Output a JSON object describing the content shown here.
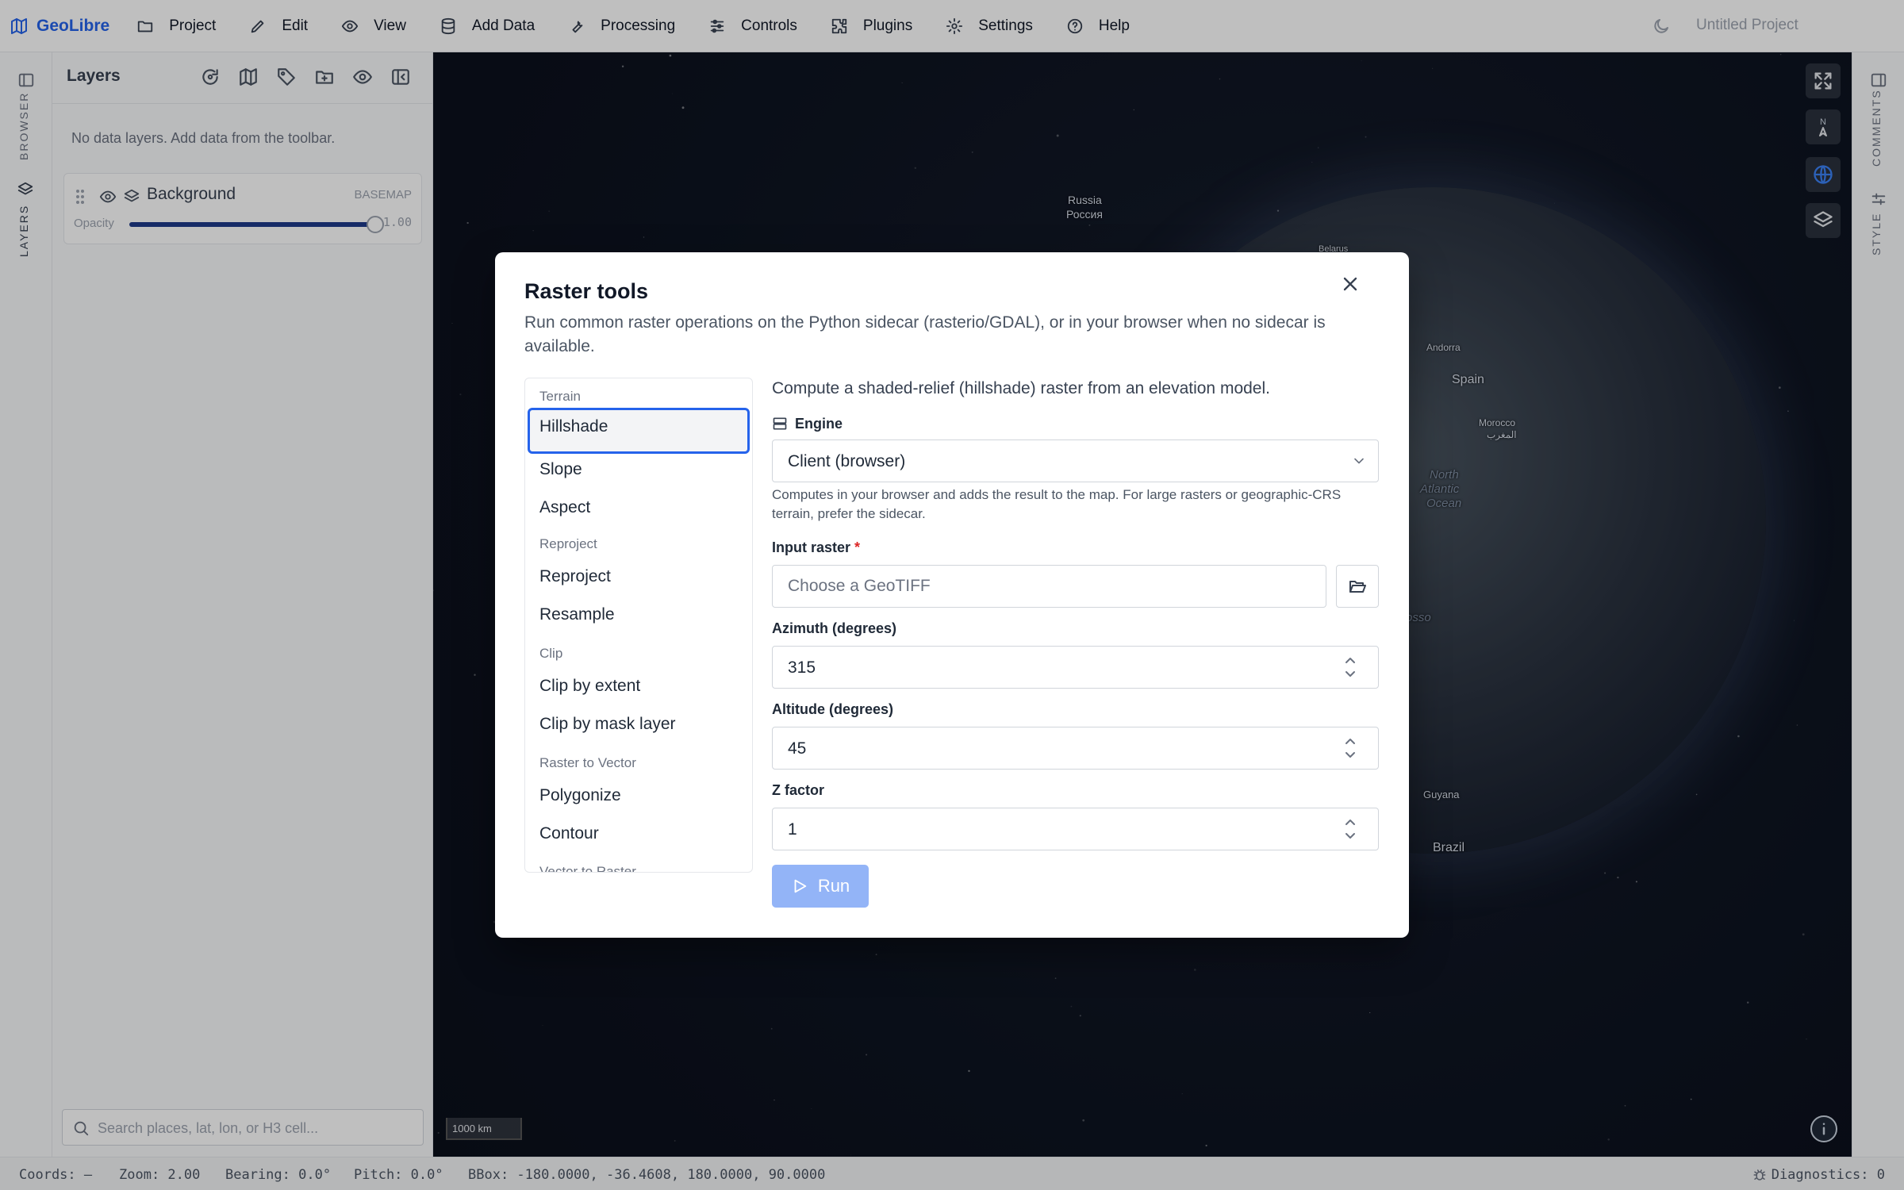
{
  "app": {
    "name": "GeoLibre",
    "project_title": "Untitled Project"
  },
  "menu": [
    {
      "id": "project",
      "label": "Project",
      "icon": "folder-icon"
    },
    {
      "id": "edit",
      "label": "Edit",
      "icon": "pencil-icon"
    },
    {
      "id": "view",
      "label": "View",
      "icon": "eye-icon"
    },
    {
      "id": "add-data",
      "label": "Add Data",
      "icon": "database-icon"
    },
    {
      "id": "processing",
      "label": "Processing",
      "icon": "wrench-icon"
    },
    {
      "id": "controls",
      "label": "Controls",
      "icon": "sliders-icon"
    },
    {
      "id": "plugins",
      "label": "Plugins",
      "icon": "puzzle-icon"
    },
    {
      "id": "settings",
      "label": "Settings",
      "icon": "gear-icon"
    },
    {
      "id": "help",
      "label": "Help",
      "icon": "help-circle-icon"
    }
  ],
  "left_rail": {
    "browser": "BROWSER",
    "layers": "LAYERS"
  },
  "right_rail": {
    "comments": "COMMENTS",
    "style": "STYLE"
  },
  "layers_panel": {
    "title": "Layers",
    "empty_message": "No data layers. Add data from the toolbar.",
    "background": {
      "name": "Background",
      "tag": "BASEMAP",
      "opacity_label": "Opacity",
      "opacity_value": "1.00",
      "opacity": 1.0
    },
    "search_placeholder": "Search places, lat, lon, or H3 cell..."
  },
  "map": {
    "places": [
      {
        "id": "russia-en",
        "text": "Russia"
      },
      {
        "id": "russia-ru",
        "text": "Россия"
      },
      {
        "id": "belarus",
        "text": "Belarus"
      },
      {
        "id": "andorra",
        "text": "Andorra"
      },
      {
        "id": "spain",
        "text": "Spain"
      },
      {
        "id": "morocco-en",
        "text": "Morocco"
      },
      {
        "id": "morocco-ar",
        "text": "المغرب"
      },
      {
        "id": "nao-1",
        "text": "North"
      },
      {
        "id": "nao-2",
        "text": "Atlantic"
      },
      {
        "id": "nao-3",
        "text": "Ocean"
      },
      {
        "id": "grosso",
        "text": "osso"
      },
      {
        "id": "guyana",
        "text": "Guyana"
      },
      {
        "id": "brazil",
        "text": "Brazil"
      }
    ],
    "compass": {
      "n": "N"
    },
    "scale": "1000 km"
  },
  "status": {
    "coords": "Coords: —",
    "zoom": "Zoom: 2.00",
    "bearing": "Bearing: 0.0°",
    "pitch": "Pitch: 0.0°",
    "bbox": "BBox: -180.0000, -36.4608, 180.0000, 90.0000",
    "diagnostics": "Diagnostics: 0"
  },
  "dialog": {
    "title": "Raster tools",
    "subtitle": "Run common raster operations on the Python sidecar (rasterio/GDAL), or in your browser when no sidecar is available.",
    "tool_list": {
      "terrain": "Terrain",
      "hillshade": "Hillshade",
      "slope": "Slope",
      "aspect": "Aspect",
      "reproject_cat": "Reproject",
      "reproject": "Reproject",
      "resample": "Resample",
      "clip_cat": "Clip",
      "clip_extent": "Clip by extent",
      "clip_mask": "Clip by mask layer",
      "r2v_cat": "Raster to Vector",
      "polygonize": "Polygonize",
      "contour": "Contour",
      "v2r_cat": "Vector to Raster"
    },
    "description": "Compute a shaded-relief (hillshade) raster from an elevation model.",
    "engine": {
      "label": "Engine",
      "value": "Client (browser)",
      "help": "Computes in your browser and adds the result to the map. For large rasters or geographic-CRS terrain, prefer the sidecar."
    },
    "input_raster": {
      "label": "Input raster",
      "required": "*",
      "placeholder": "Choose a GeoTIFF"
    },
    "azimuth": {
      "label": "Azimuth (degrees)",
      "value": "315"
    },
    "altitude": {
      "label": "Altitude (degrees)",
      "value": "45"
    },
    "zfactor": {
      "label": "Z factor",
      "value": "1"
    },
    "run_label": "Run"
  },
  "colors": {
    "accent": "#2563eb",
    "run_disabled": "#93b4f7",
    "required": "#dc2626"
  }
}
